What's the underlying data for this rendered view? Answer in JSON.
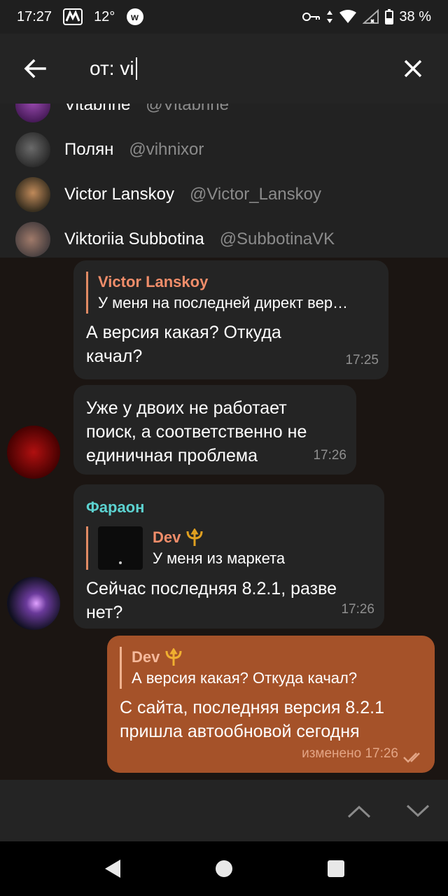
{
  "status_bar": {
    "time": "17:27",
    "temperature": "12°",
    "battery": "38 %"
  },
  "search": {
    "query": "от: vi"
  },
  "mentions": [
    {
      "name": "Vitabrine",
      "username": "@Vitabrine",
      "avatar_color": "#5a2a6a"
    },
    {
      "name": "Полян",
      "username": "@vihnixor",
      "avatar_color": "#3a3a3a"
    },
    {
      "name": "Victor Lanskoy",
      "username": "@Victor_Lanskoy",
      "avatar_color": "#7a5a3a"
    },
    {
      "name": "Viktoriia Subbotina",
      "username": "@SubbotinaVK",
      "avatar_color": "#6a5a5a"
    }
  ],
  "messages": [
    {
      "reply_name": "Victor Lanskoy",
      "reply_text": "У меня на последней директ вер…",
      "lines": [
        "А версия какая? Откуда",
        "качал?"
      ],
      "time": "17:25"
    },
    {
      "lines": [
        "Уже у двоих не работает",
        "поиск, а соответственно не",
        "единичная проблема"
      ],
      "time": "17:26"
    },
    {
      "sender": "Фараон",
      "reply_name": "Dev",
      "reply_text": "У меня из маркета",
      "lines": [
        "Сейчас последняя 8.2.1, разве",
        "нет?"
      ],
      "time": "17:26"
    },
    {
      "reply_name": "Dev",
      "reply_text": "А версия какая? Откуда качал?",
      "lines": [
        "С сайта, последняя версия 8.2.1",
        "пришла автообновой сегодня"
      ],
      "time": "изменено 17:26"
    }
  ],
  "colors": {
    "accent": "#f08d6a",
    "outgoing": "#a55229",
    "sender": "#5cd2d0"
  }
}
